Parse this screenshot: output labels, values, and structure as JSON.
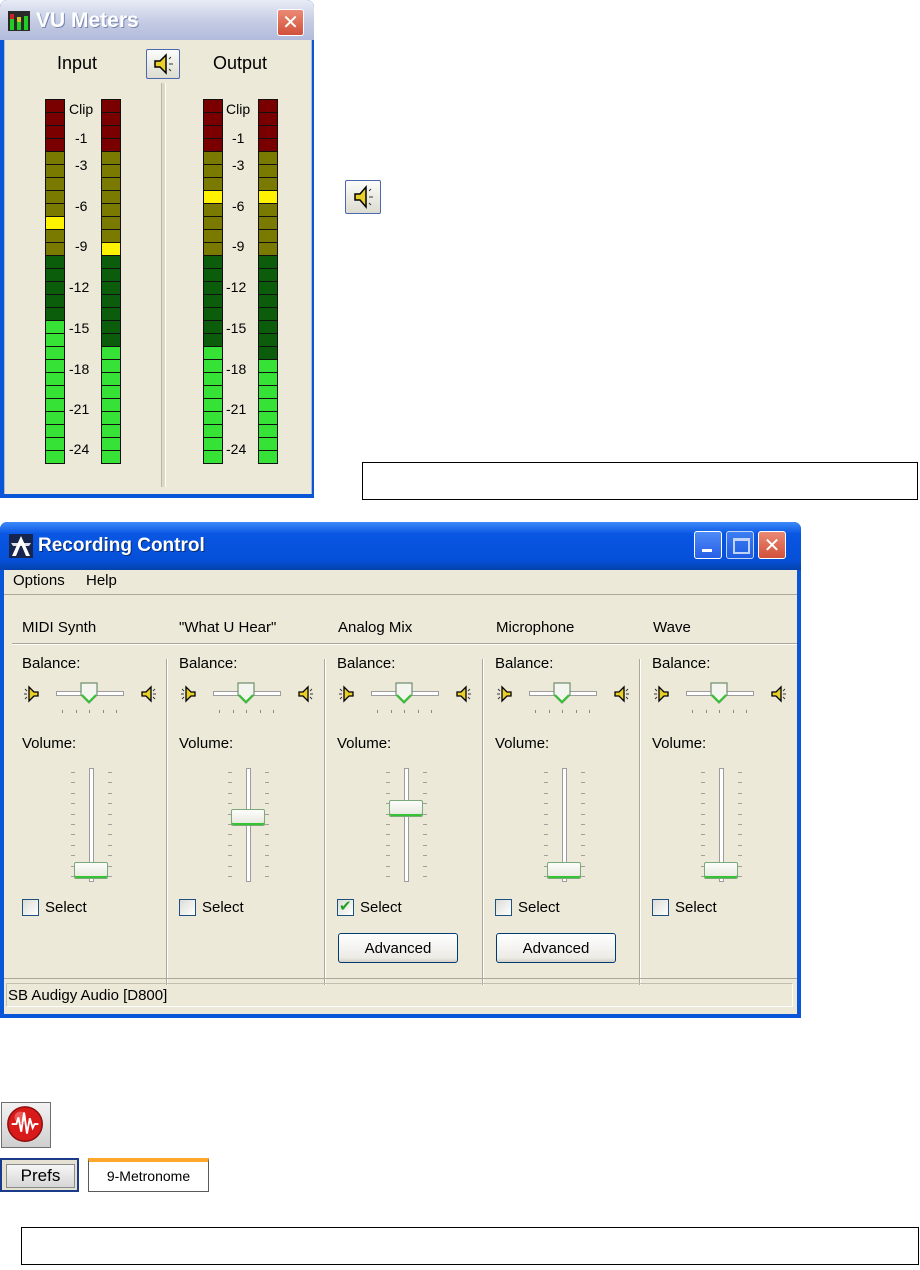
{
  "vu_meters": {
    "title": "VU Meters",
    "close_icon": "close-icon",
    "input_label": "Input",
    "output_label": "Output",
    "speaker_icon": "speaker-icon",
    "scale_labels": [
      "Clip",
      "-1",
      "-3",
      "-6",
      "-9",
      "-12",
      "-15",
      "-18",
      "-21",
      "-24"
    ],
    "meters": [
      {
        "name": "input-left",
        "lit_segments": 21,
        "peak_segment": 18
      },
      {
        "name": "input-right",
        "lit_segments": 19,
        "peak_segment": 16
      },
      {
        "name": "output-left",
        "lit_segments": 19,
        "peak_segment": 20
      },
      {
        "name": "output-right",
        "lit_segments": 18,
        "peak_segment": 20
      }
    ]
  },
  "standalone_icon": "speaker-icon",
  "recording_control": {
    "title": "Recording Control",
    "menu": [
      "Options",
      "Help"
    ],
    "balance_label": "Balance:",
    "volume_label": "Volume:",
    "select_label": "Select",
    "advanced_label": "Advanced",
    "channels": [
      {
        "name": "MIDI Synth",
        "balance": 0.5,
        "volume": 0.0,
        "selected": false,
        "advanced": false
      },
      {
        "name": "\"What U Hear\"",
        "balance": 0.5,
        "volume": 0.6,
        "selected": false,
        "advanced": false
      },
      {
        "name": "Analog Mix",
        "balance": 0.5,
        "volume": 0.7,
        "selected": true,
        "advanced": true
      },
      {
        "name": "Microphone",
        "balance": 0.5,
        "volume": 0.0,
        "selected": false,
        "advanced": true
      },
      {
        "name": "Wave",
        "balance": 0.5,
        "volume": 0.0,
        "selected": false,
        "advanced": false
      }
    ],
    "status": "SB Audigy Audio [D800]"
  },
  "toolbar": {
    "record_icon": "record-icon",
    "prefs_label": "Prefs",
    "metronome_label": "9-Metronome"
  },
  "colors": {
    "xp_blue": "#0a56d8",
    "clip_red": "#7a0000",
    "olive": "#7a7a00",
    "dark_green": "#0b5c0b",
    "bright_green": "#36e236",
    "peak_yellow": "#fff200"
  }
}
